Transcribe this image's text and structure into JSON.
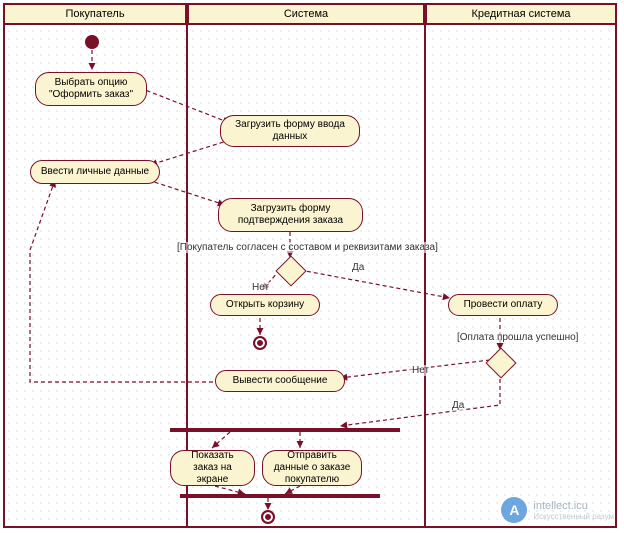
{
  "lanes": {
    "buyer": "Покупатель",
    "system": "Система",
    "credit": "Кредитная система"
  },
  "nodes": {
    "choose_option": "Выбрать опцию \"Оформить заказ\"",
    "load_form": "Загрузить форму ввода данных",
    "enter_data": "Ввести личные данные",
    "load_confirm": "Загрузить форму подтверждения заказа",
    "open_cart": "Открыть корзину",
    "process_payment": "Провести оплату",
    "show_message": "Вывести сообщение",
    "show_order": "Показать заказ на экране",
    "send_data": "Отправить данные о заказе покупателю"
  },
  "guards": {
    "main": "[Покупатель согласен с составом и реквизитами заказа]",
    "payment": "[Оплата прошла успешно]",
    "yes": "Да",
    "no": "Нет"
  },
  "watermark": {
    "letter": "A",
    "title": "intellect.icu",
    "sub": "Искусственный разум"
  }
}
